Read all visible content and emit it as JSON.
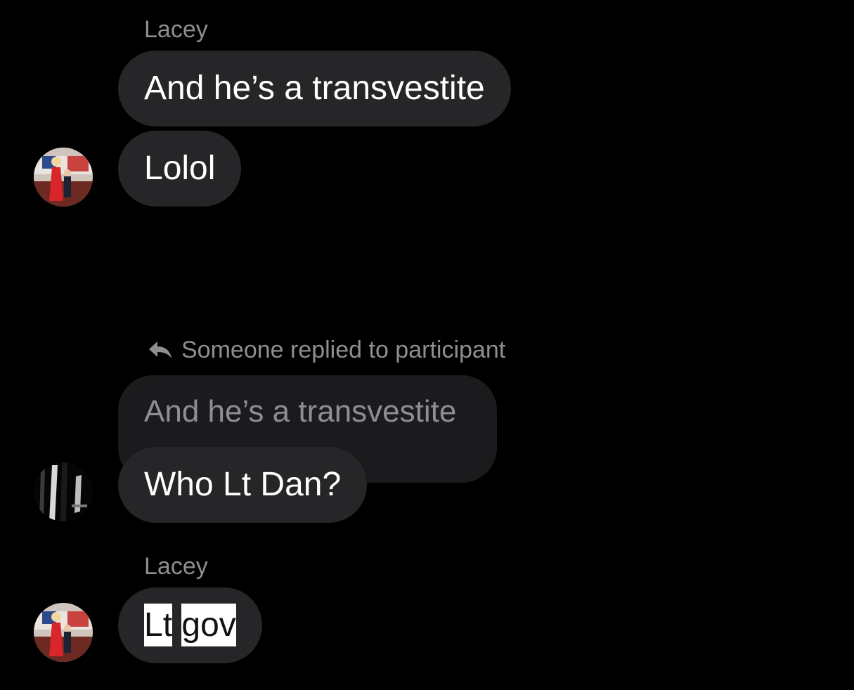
{
  "conversation": {
    "group1": {
      "sender": "Lacey",
      "messages": [
        "And he’s a transvestite",
        "Lolol"
      ]
    },
    "reply": {
      "context": "Someone replied to participant",
      "quoted": "And he’s a transvestite",
      "message": "Who Lt Dan?"
    },
    "group2": {
      "sender": "Lacey",
      "message_parts": [
        "Lt",
        "gov"
      ]
    }
  },
  "icons": {
    "reply": "reply-arrow-icon"
  },
  "colors": {
    "background": "#000000",
    "bubble": "#262628",
    "quoted_bubble": "#1b1b1d",
    "secondary_text": "#8e8e93",
    "highlight": "#ffffff"
  }
}
